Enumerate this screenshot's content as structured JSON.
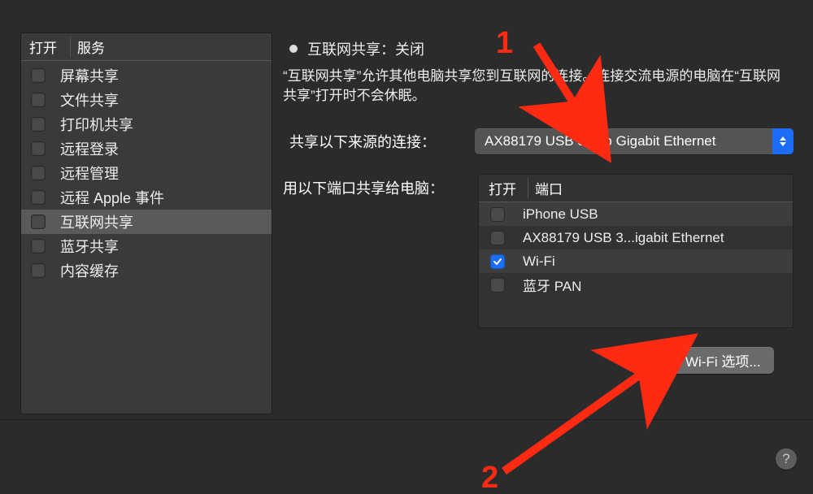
{
  "leftPanel": {
    "header": {
      "col1": "打开",
      "col2": "服务"
    },
    "items": [
      {
        "label": "屏幕共享",
        "checked": false,
        "selected": false
      },
      {
        "label": "文件共享",
        "checked": false,
        "selected": false
      },
      {
        "label": "打印机共享",
        "checked": false,
        "selected": false
      },
      {
        "label": "远程登录",
        "checked": false,
        "selected": false
      },
      {
        "label": "远程管理",
        "checked": false,
        "selected": false
      },
      {
        "label": "远程 Apple 事件",
        "checked": false,
        "selected": false
      },
      {
        "label": "互联网共享",
        "checked": false,
        "selected": true
      },
      {
        "label": "蓝牙共享",
        "checked": false,
        "selected": false
      },
      {
        "label": "内容缓存",
        "checked": false,
        "selected": false
      }
    ]
  },
  "status": {
    "title": "互联网共享：关闭"
  },
  "description": "“互联网共享”允许其他电脑共享您到互联网的连接。连接交流电源的电脑在“互联网共享”打开时不会休眠。",
  "shareFrom": {
    "label": "共享以下来源的连接：",
    "value": "AX88179 USB 3.0 to Gigabit Ethernet"
  },
  "ports": {
    "label": "用以下端口共享给电脑：",
    "header": {
      "col1": "打开",
      "col2": "端口"
    },
    "items": [
      {
        "label": "iPhone USB",
        "checked": false
      },
      {
        "label": "AX88179 USB 3...igabit Ethernet",
        "checked": false
      },
      {
        "label": "Wi-Fi",
        "checked": true
      },
      {
        "label": "蓝牙 PAN",
        "checked": false
      }
    ]
  },
  "wifiButton": "Wi-Fi 选项...",
  "help": "?",
  "annotations": {
    "one": "1",
    "two": "2"
  }
}
